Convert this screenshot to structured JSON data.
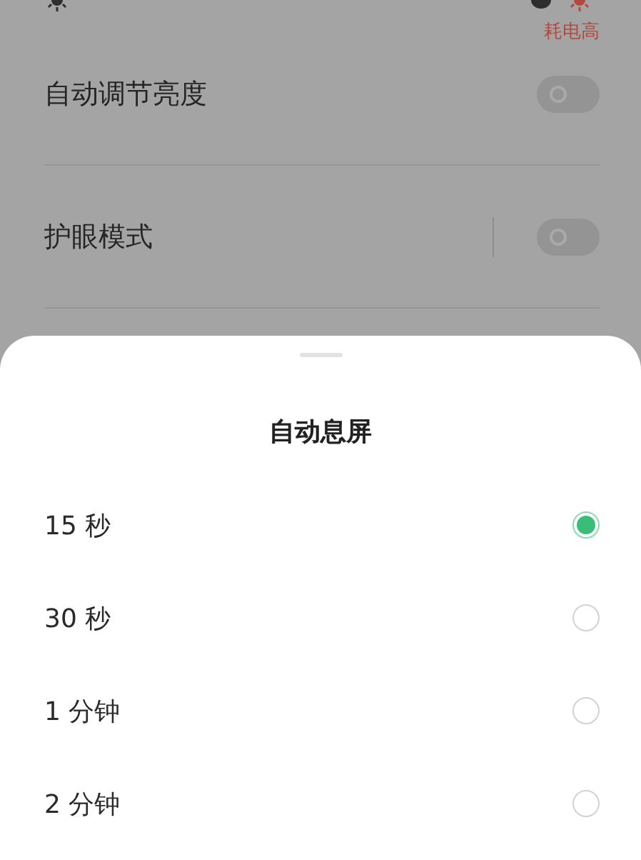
{
  "status_strip": {
    "power_hint": "耗电高"
  },
  "settings": [
    {
      "label": "自动调节亮度",
      "on": false,
      "separator": false
    },
    {
      "label": "护眼模式",
      "on": false,
      "separator": true
    }
  ],
  "sheet": {
    "title": "自动息屏",
    "options": [
      {
        "label": "15 秒",
        "selected": true
      },
      {
        "label": "30 秒",
        "selected": false
      },
      {
        "label": "1 分钟",
        "selected": false
      },
      {
        "label": "2 分钟",
        "selected": false
      }
    ]
  }
}
